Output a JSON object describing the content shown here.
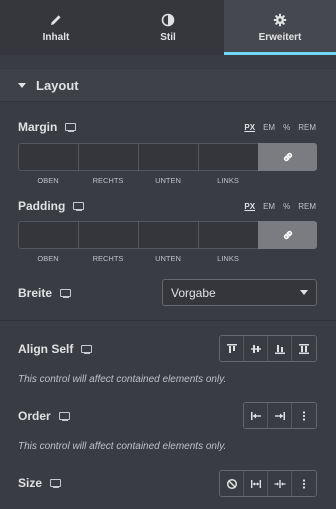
{
  "tabs": [
    {
      "label": "Inhalt",
      "icon": "pencil-icon"
    },
    {
      "label": "Stil",
      "icon": "contrast-icon"
    },
    {
      "label": "Erweitert",
      "icon": "gear-icon",
      "active": true
    }
  ],
  "section": {
    "title": "Layout"
  },
  "margin": {
    "label": "Margin",
    "units": [
      "PX",
      "EM",
      "%",
      "REM"
    ],
    "active_unit": "PX",
    "sides": [
      "OBEN",
      "RECHTS",
      "UNTEN",
      "LINKS"
    ]
  },
  "padding": {
    "label": "Padding",
    "units": [
      "PX",
      "EM",
      "%",
      "REM"
    ],
    "active_unit": "PX",
    "sides": [
      "OBEN",
      "RECHTS",
      "UNTEN",
      "LINKS"
    ]
  },
  "width": {
    "label": "Breite",
    "value": "Vorgabe"
  },
  "align_self": {
    "label": "Align Self",
    "note": "This control will affect contained elements only."
  },
  "order": {
    "label": "Order",
    "note": "This control will affect contained elements only."
  },
  "size": {
    "label": "Size"
  },
  "colors": {
    "accent": "#71d7f7",
    "background": "#3a3c43"
  }
}
